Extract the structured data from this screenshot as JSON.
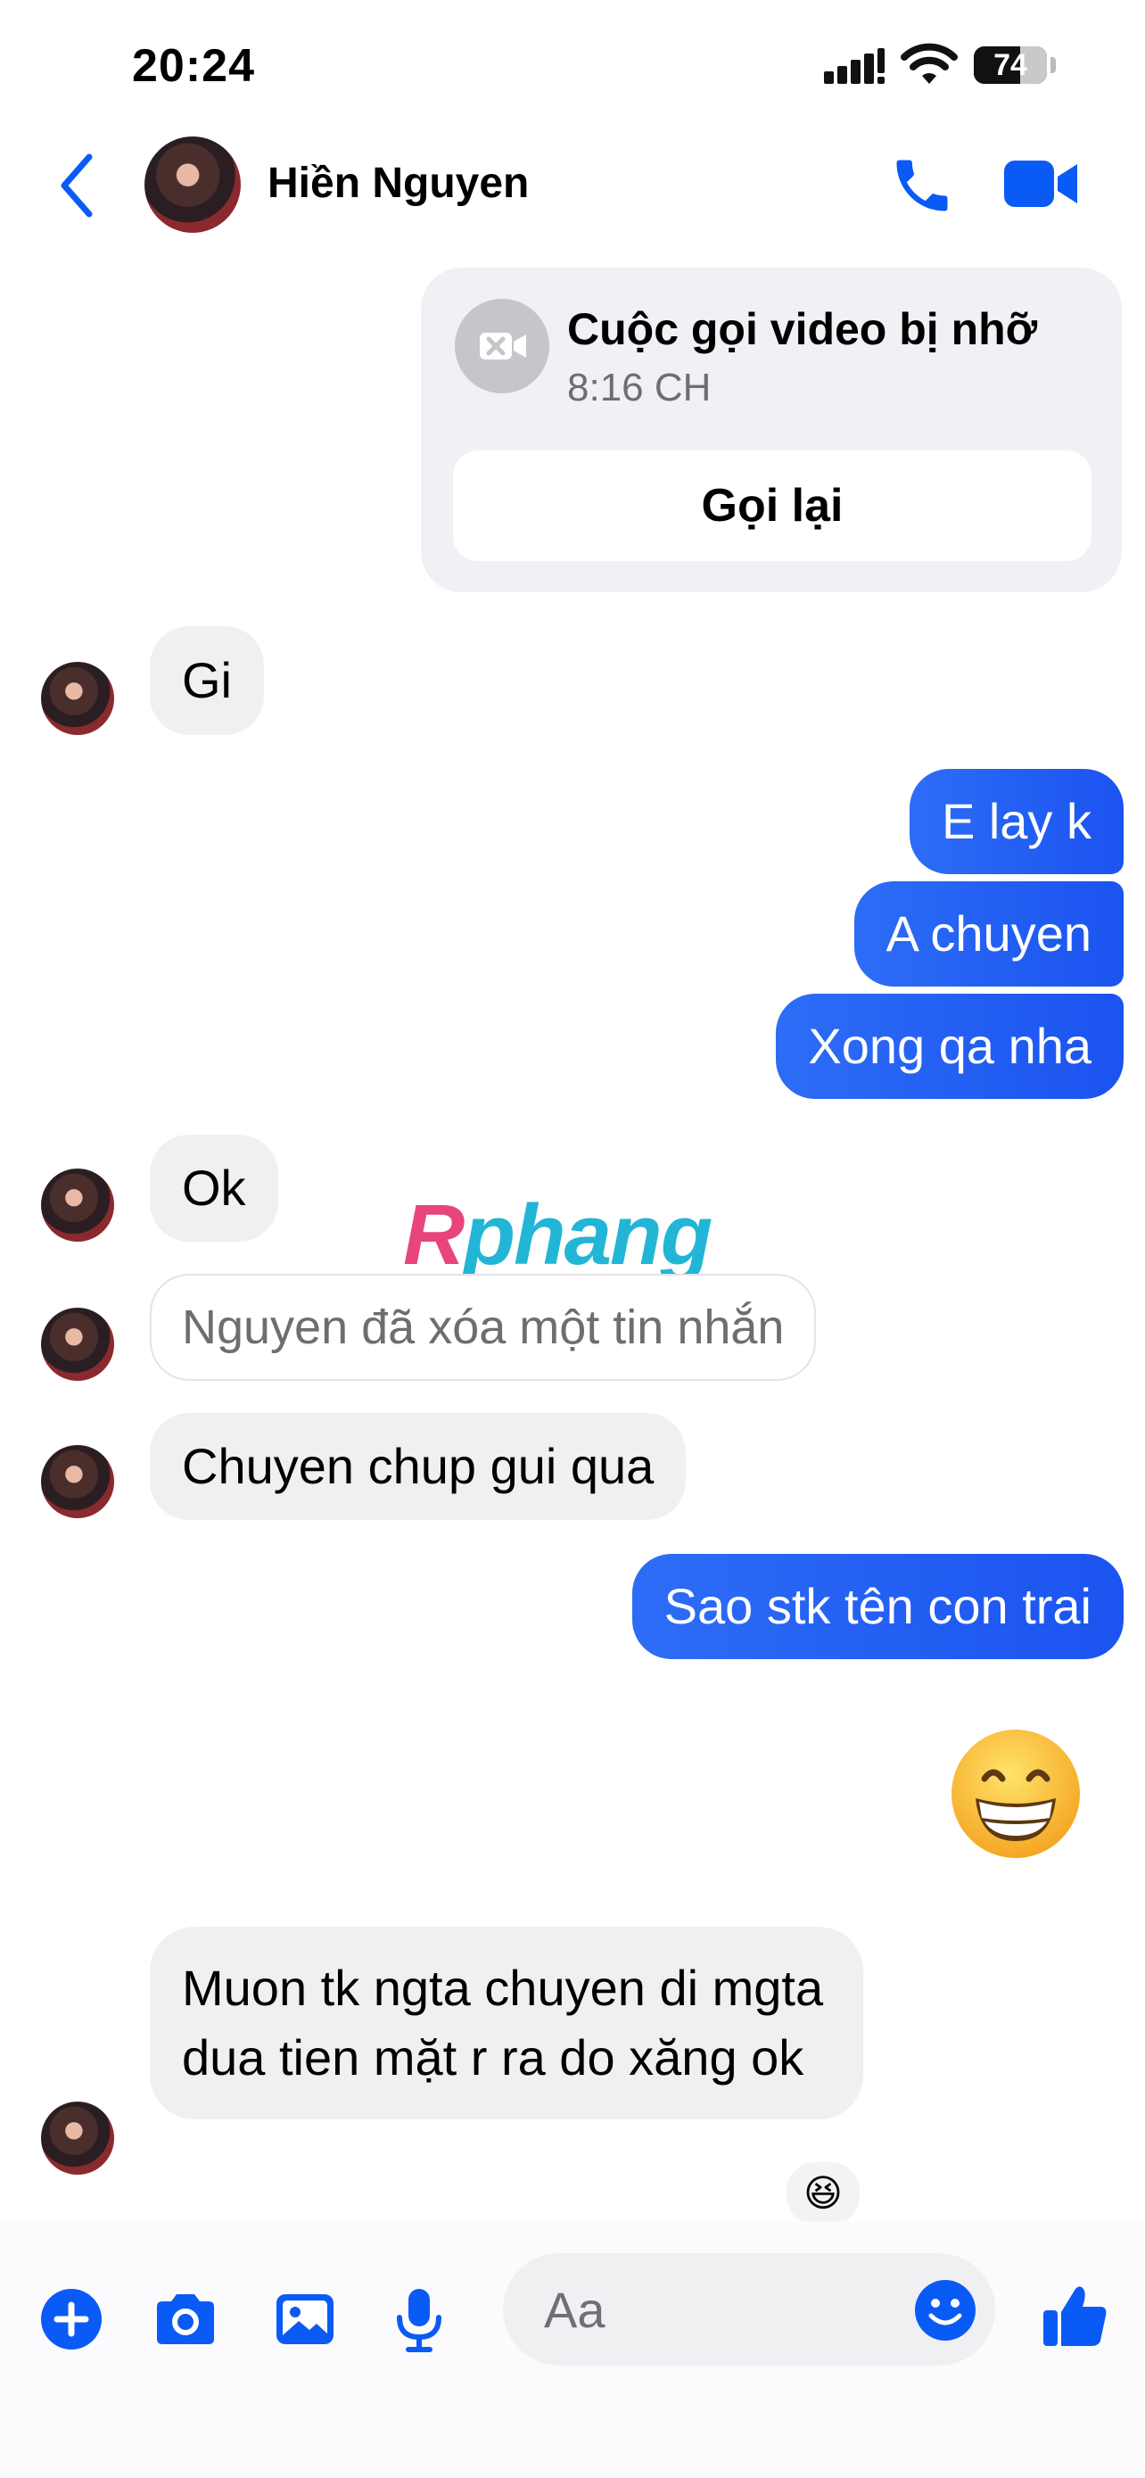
{
  "status_bar": {
    "time": "20:24",
    "battery": "74"
  },
  "header": {
    "contact_name": "Hiền Nguyen"
  },
  "missed_call": {
    "title": "Cuộc gọi video bị nhỡ",
    "time": "8:16 CH",
    "callback_label": "Gọi lại"
  },
  "messages": [
    {
      "side": "in",
      "text": "Gi"
    },
    {
      "side": "out",
      "text": "E lay k"
    },
    {
      "side": "out",
      "text": "A chuyen"
    },
    {
      "side": "out",
      "text": "Xong qa nha"
    },
    {
      "side": "in",
      "text": "Ok"
    },
    {
      "side": "in",
      "text": "Nguyen đã xóa một tin nhắn",
      "deleted": true
    },
    {
      "side": "in",
      "text": "Chuyen chup gui qua"
    },
    {
      "side": "out",
      "text": "Sao stk tên con trai"
    },
    {
      "side": "out",
      "emoji": "😁"
    },
    {
      "side": "in",
      "text": "Muon tk ngta chuyen di mgta dua tien mặt r ra do xăng ok",
      "reaction": "😆"
    }
  ],
  "watermark": {
    "first": "R",
    "rest": "phang"
  },
  "composer": {
    "placeholder": "Aa"
  },
  "colors": {
    "accent": "#1b53f0",
    "incoming_bubble": "#f0f0f3",
    "icon_blue": "#0a5bf5"
  },
  "icons": [
    "back-chevron-icon",
    "phone-icon",
    "video-icon",
    "video-off-icon",
    "plus-icon",
    "camera-icon",
    "image-icon",
    "microphone-icon",
    "smiley-icon",
    "thumbs-up-icon"
  ]
}
